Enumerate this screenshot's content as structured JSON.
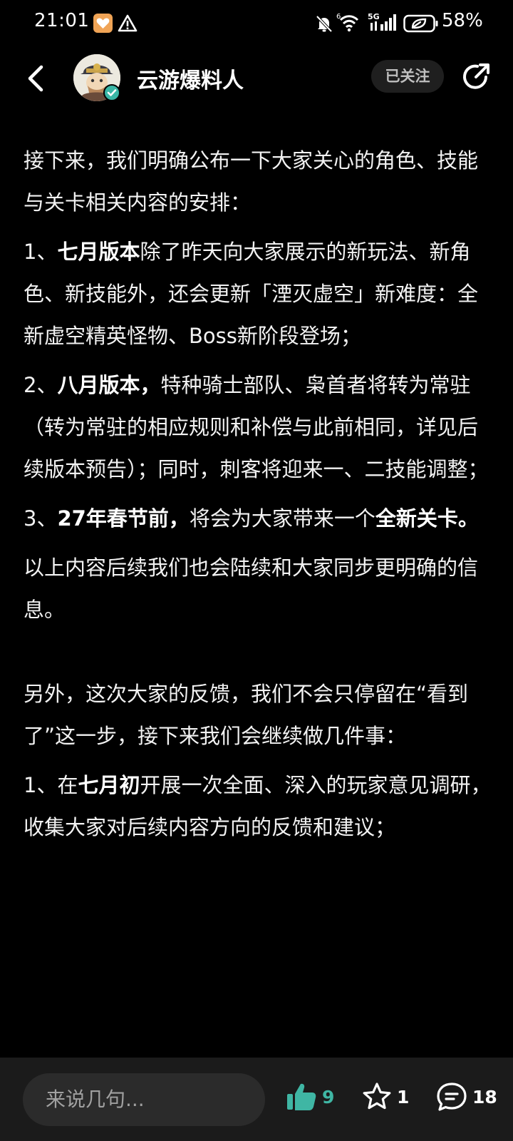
{
  "status_bar": {
    "time": "21:01",
    "network_label": "5G",
    "wifi_label": "6",
    "battery": "58%"
  },
  "header": {
    "account_name": "云游爆料人",
    "follow_label": "已关注"
  },
  "article": {
    "para1": "接下来，我们明确公布一下大家关心的角色、技能与关卡相关内容的安排：",
    "item1_prefix": "1、",
    "item1_bold": "七月版本",
    "item1_rest": "除了昨天向大家展示的新玩法、新角色、新技能外，还会更新「湮灭虚空」新难度：全新虚空精英怪物、Boss新阶段登场；",
    "item2_prefix": "2、",
    "item2_bold": "八月版本，",
    "item2_rest": "特种骑士部队、枭首者将转为常驻（转为常驻的相应规则和补偿与此前相同，详见后续版本预告）；同时，刺客将迎来一、二技能调整；",
    "item3_prefix": "3、",
    "item3_bold": "27年春节前，",
    "item3_mid": "将会为大家带来一个",
    "item3_bold2": "全新关卡。",
    "para2": "以上内容后续我们也会陆续和大家同步更明确的信息。",
    "para3": "另外，这次大家的反馈，我们不会只停留在“看到了”这一步，接下来我们会继续做几件事：",
    "item4_prefix": "1、在",
    "item4_bold": "七月初",
    "item4_rest": "开展一次全面、深入的玩家意见调研，收集大家对后续内容方向的反馈和建议；"
  },
  "bottom_bar": {
    "comment_placeholder": "来说几句...",
    "like_count": "9",
    "favorite_count": "1",
    "comment_count": "18"
  },
  "colors": {
    "accent": "#3fb6a4",
    "background": "#000000",
    "bar": "#1b1b1b"
  }
}
